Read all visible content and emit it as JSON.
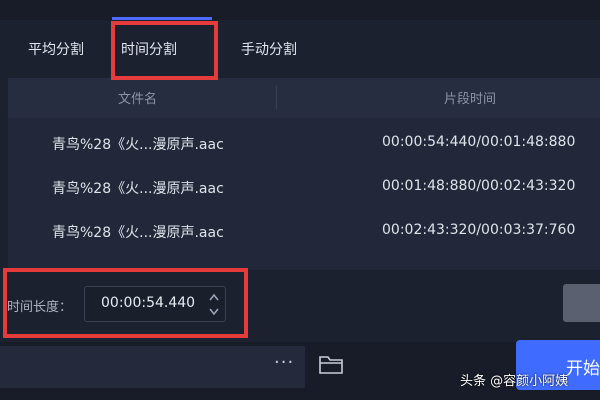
{
  "tabs": [
    {
      "label": "平均分割"
    },
    {
      "label": "时间分割"
    },
    {
      "label": "手动分割"
    }
  ],
  "table": {
    "headers": [
      "文件名",
      "片段时间"
    ],
    "rows": [
      {
        "file": "青鸟%28《火...漫原声.aac",
        "time": "00:00:54:440/00:01:48:880"
      },
      {
        "file": "青鸟%28《火...漫原声.aac",
        "time": "00:01:48:880/00:02:43:320"
      },
      {
        "file": "青鸟%28《火...漫原声.aac",
        "time": "00:02:43:320/00:03:37:760"
      }
    ]
  },
  "length": {
    "label": "时间长度：",
    "value": "00:00:54.440"
  },
  "footer": {
    "more": "···",
    "start_label": "开始"
  },
  "watermark": "头条 @容颜小阿姨",
  "colors": {
    "accent": "#3f6bff",
    "highlight": "#e53b3b",
    "background": "#1c2130"
  }
}
